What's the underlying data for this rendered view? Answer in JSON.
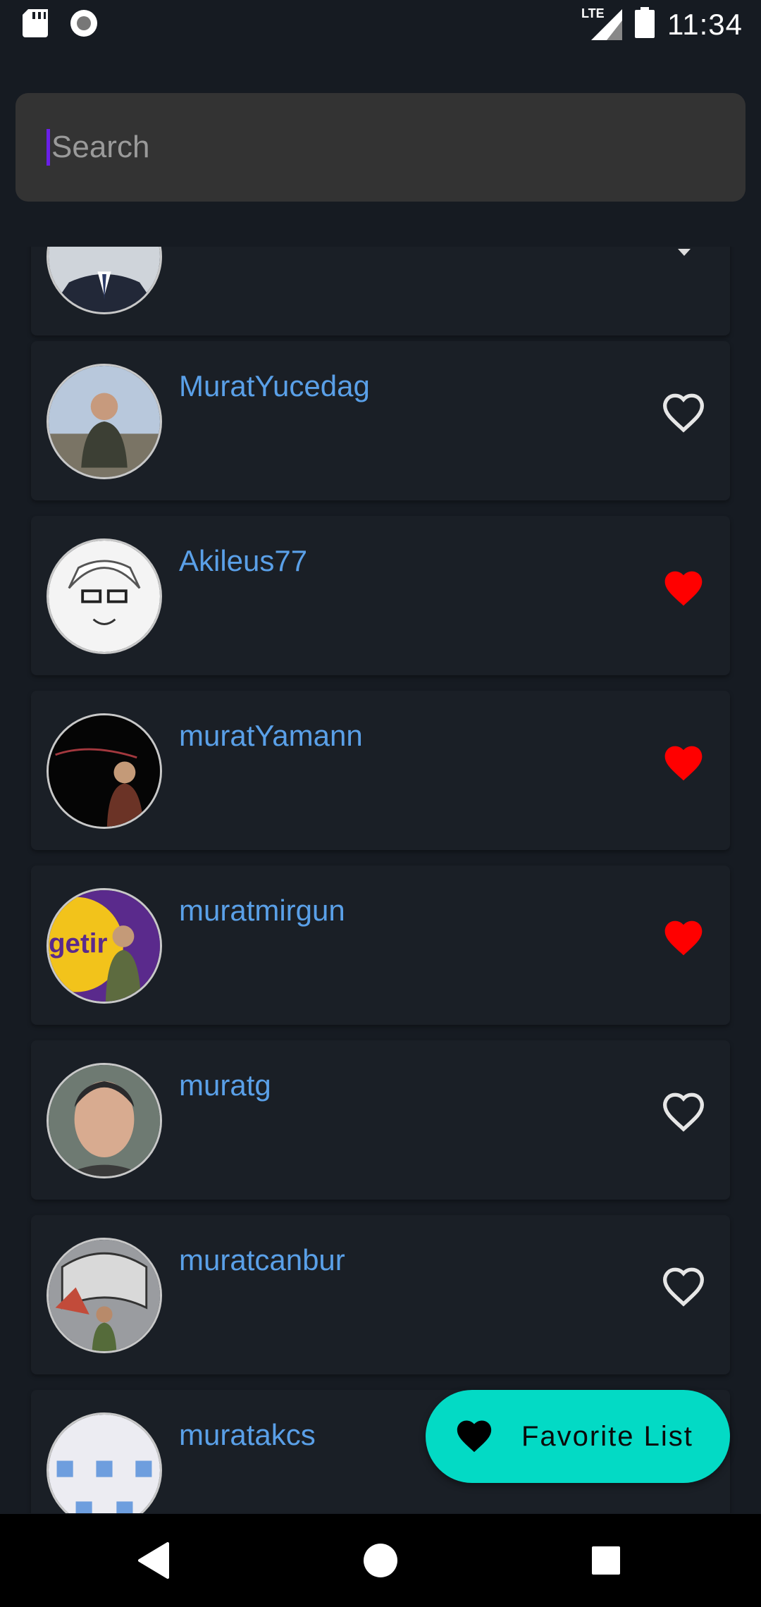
{
  "status_bar": {
    "time": "11:34",
    "network": "LTE",
    "icons": [
      "sd-card-icon",
      "record-icon",
      "signal-icon",
      "battery-icon"
    ]
  },
  "search": {
    "placeholder": "Search",
    "value": ""
  },
  "users": [
    {
      "username": "",
      "favorite": false,
      "partial": true
    },
    {
      "username": "MuratYucedag",
      "favorite": false
    },
    {
      "username": "Akileus77",
      "favorite": true
    },
    {
      "username": "muratYamann",
      "favorite": true
    },
    {
      "username": "muratmirgun",
      "favorite": true
    },
    {
      "username": "muratg",
      "favorite": false
    },
    {
      "username": "muratcanbur",
      "favorite": false
    },
    {
      "username": "muratakcs",
      "favorite": false
    }
  ],
  "fab": {
    "label": "Favorite List",
    "icon": "heart-icon"
  },
  "colors": {
    "background": "#161b22",
    "card": "#1a1f26",
    "username": "#5aa0e8",
    "heart_filled": "#ff0000",
    "fab": "#03dac5"
  },
  "navbar": {
    "icons": [
      "back-icon",
      "home-icon",
      "recents-icon"
    ]
  }
}
